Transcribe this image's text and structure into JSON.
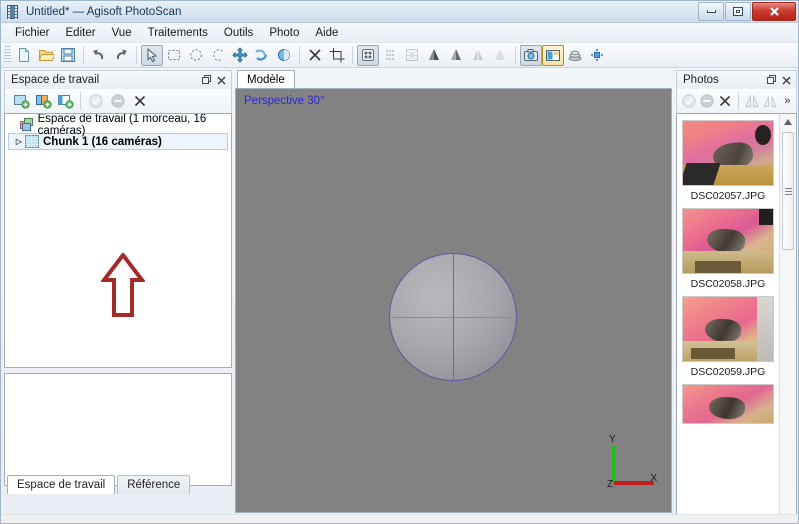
{
  "window": {
    "title": "Untitled* — Agisoft PhotoScan",
    "icon": "filmstrip-icon",
    "controls": {
      "minimize": "—",
      "maximize": "▢",
      "close": "✕"
    }
  },
  "menubar": {
    "items": [
      {
        "label": "Fichier",
        "name": "menu-fichier"
      },
      {
        "label": "Editer",
        "name": "menu-editer"
      },
      {
        "label": "Vue",
        "name": "menu-vue"
      },
      {
        "label": "Traitements",
        "name": "menu-traitements"
      },
      {
        "label": "Outils",
        "name": "menu-outils"
      },
      {
        "label": "Photo",
        "name": "menu-photo"
      },
      {
        "label": "Aide",
        "name": "menu-aide"
      }
    ]
  },
  "toolbar": {
    "buttons": [
      {
        "name": "new-document-icon",
        "state": "normal"
      },
      {
        "name": "open-folder-icon",
        "state": "normal"
      },
      {
        "name": "save-icon",
        "state": "normal"
      },
      {
        "name": "undo-icon",
        "state": "normal"
      },
      {
        "name": "redo-icon",
        "state": "normal"
      },
      {
        "name": "cursor-select-icon",
        "state": "pressed"
      },
      {
        "name": "rectangle-selection-icon",
        "state": "normal"
      },
      {
        "name": "circle-selection-icon",
        "state": "normal"
      },
      {
        "name": "freeform-selection-icon",
        "state": "normal"
      },
      {
        "name": "move-object-icon",
        "state": "normal"
      },
      {
        "name": "rotate-object-icon",
        "state": "normal"
      },
      {
        "name": "scale-object-icon",
        "state": "normal"
      },
      {
        "name": "delete-selection-icon",
        "state": "normal"
      },
      {
        "name": "crop-selection-icon",
        "state": "normal"
      },
      {
        "name": "point-cloud-icon",
        "state": "pressed"
      },
      {
        "name": "dense-cloud-icon",
        "state": "disabled"
      },
      {
        "name": "mesh-wireframe-icon",
        "state": "disabled"
      },
      {
        "name": "shaded-model-icon",
        "state": "normal"
      },
      {
        "name": "solid-model-icon",
        "state": "normal"
      },
      {
        "name": "wireframe-model-icon",
        "state": "disabled"
      },
      {
        "name": "textured-model-icon",
        "state": "disabled"
      },
      {
        "name": "show-cameras-icon",
        "state": "pressed"
      },
      {
        "name": "show-thumbnails-icon",
        "state": "active"
      },
      {
        "name": "region-icon",
        "state": "normal"
      },
      {
        "name": "reset-view-icon",
        "state": "normal"
      }
    ]
  },
  "workspace": {
    "panel_title": "Espace de travail",
    "float_icon": "restore-icon",
    "close_icon": "close-icon",
    "toolbar": [
      {
        "name": "add-chunk-icon"
      },
      {
        "name": "add-photos-icon"
      },
      {
        "name": "add-folder-icon"
      },
      {
        "name": "enable-icon"
      },
      {
        "name": "disable-icon"
      },
      {
        "name": "remove-items-icon"
      }
    ],
    "tree": {
      "root": {
        "label": "Espace de travail (1 morceau, 16 caméras)",
        "icon": "workspace-icon"
      },
      "chunk": {
        "label": "Chunk 1 (16 caméras)",
        "icon": "chunk-icon",
        "expander": "▷",
        "selected": true
      }
    },
    "tabs": [
      {
        "label": "Espace de travail",
        "selected": true
      },
      {
        "label": "Référence",
        "selected": false
      }
    ]
  },
  "model": {
    "tab_label": "Modèle",
    "projection_label": "Perspective 30°",
    "projection_color": "#2b2bd0",
    "background_color": "#828282",
    "sphere": {
      "name": "bounding-sphere",
      "outline_color": "#5a5aa0",
      "vertical_axis_color": "#a85b55",
      "horizontal_axis_color": "#5fae5f"
    },
    "axis_gizmo": {
      "x_label": "X",
      "y_label": "Y",
      "z_label": "Z",
      "x_color": "#c21c1c",
      "y_color": "#1ec01e"
    }
  },
  "photos": {
    "panel_title": "Photos",
    "float_icon": "restore-icon",
    "close_icon": "close-icon",
    "toolbar": [
      {
        "name": "enable-photo-icon"
      },
      {
        "name": "disable-photo-icon"
      },
      {
        "name": "remove-photo-icon"
      },
      {
        "name": "align-photo-icon"
      },
      {
        "name": "reset-align-icon"
      },
      {
        "name": "more-options-icon",
        "label": "»"
      }
    ],
    "items": [
      {
        "name": "DSC02057.JPG"
      },
      {
        "name": "DSC02058.JPG"
      },
      {
        "name": "DSC02059.JPG"
      },
      {
        "name": ""
      }
    ],
    "scrollbar": {
      "up_arrow": "▲"
    }
  },
  "annotation": {
    "arrow": {
      "name": "red-up-arrow-annotation",
      "direction": "up",
      "stroke_color": "#a32b28",
      "fill_color": "#ffffff"
    }
  }
}
